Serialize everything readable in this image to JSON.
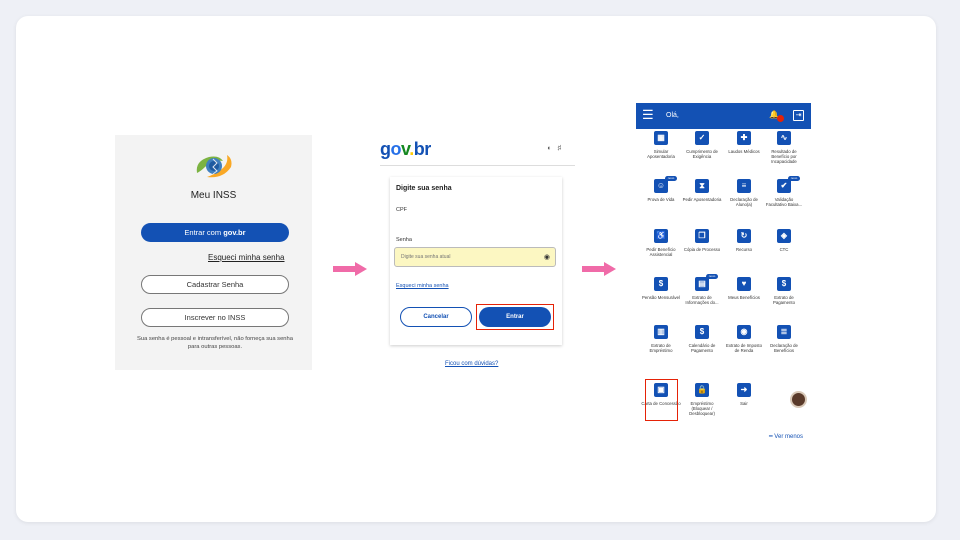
{
  "panel1": {
    "title": "Meu INSS",
    "login_prefix": "Entrar com ",
    "login_brand": "gov.br",
    "forgot": "Esqueci minha senha",
    "register": "Cadastrar Senha",
    "subscribe": "Inscrever no INSS",
    "note": "Sua senha é pessoal e intransferível, não forneça sua senha para outras pessoas."
  },
  "panel2": {
    "logo": [
      "g",
      "o",
      "v",
      ".",
      "br"
    ],
    "heading": "Digite sua senha",
    "cpf_label": "CPF",
    "password_label": "Senha",
    "password_placeholder": "Digite sua senha atual",
    "forgot": "Esqueci minha senha",
    "cancel": "Cancelar",
    "enter": "Entrar",
    "doubts": "Ficou com dúvidas?"
  },
  "panel3": {
    "greeting": "Olá,",
    "see_less": "━ Ver menos",
    "items": [
      {
        "label": "Simular Aposentadoria",
        "icon": "calculator-icon",
        "glyph": "▦"
      },
      {
        "label": "Cumprimento de Exigência",
        "icon": "check-icon",
        "glyph": "✓"
      },
      {
        "label": "Laudos Médicos",
        "icon": "medical-report-icon",
        "glyph": "✚"
      },
      {
        "label": "Resultado de Benefício por Incapacidade",
        "icon": "pulse-icon",
        "glyph": "∿"
      },
      {
        "label": "Prova de Vida",
        "icon": "face-scan-icon",
        "glyph": "☺",
        "badge": "novo"
      },
      {
        "label": "Pedir Aposentadoria",
        "icon": "hourglass-icon",
        "glyph": "⧗"
      },
      {
        "label": "Declaração de Aluno(a)",
        "icon": "document-icon",
        "glyph": "≡"
      },
      {
        "label": "Validação Facultativo Baixa...",
        "icon": "user-check-icon",
        "glyph": "✔",
        "badge": "novo"
      },
      {
        "label": "Pedir Benefício Assistencial",
        "icon": "wheelchair-icon",
        "glyph": "♿"
      },
      {
        "label": "Cópia de Processo",
        "icon": "copy-icon",
        "glyph": "❐"
      },
      {
        "label": "Recurso",
        "icon": "appeal-icon",
        "glyph": "↻"
      },
      {
        "label": "CTC",
        "icon": "certificate-icon",
        "glyph": "◈"
      },
      {
        "label": "Pensão Mensurável",
        "icon": "hand-coin-icon",
        "glyph": "$"
      },
      {
        "label": "Extrato de Informações do...",
        "icon": "statement-icon",
        "glyph": "▤",
        "badge": "novo"
      },
      {
        "label": "Meus Benefícios",
        "icon": "benefits-icon",
        "glyph": "♥"
      },
      {
        "label": "Extrato de Pagamento",
        "icon": "payment-statement-icon",
        "glyph": "$"
      },
      {
        "label": "Extrato de Empréstimo",
        "icon": "loan-statement-icon",
        "glyph": "▥"
      },
      {
        "label": "Calendário de Pagamento",
        "icon": "calendar-icon",
        "glyph": "$"
      },
      {
        "label": "Extrato de Imposto de Renda",
        "icon": "tax-icon",
        "glyph": "◉"
      },
      {
        "label": "Declaração de Benefícios",
        "icon": "declaration-icon",
        "glyph": "≣"
      },
      {
        "label": "Carta de Concessão",
        "icon": "award-letter-icon",
        "glyph": "▣"
      },
      {
        "label": "Empréstimo (Bloquear / Desbloquear)",
        "icon": "lock-hand-icon",
        "glyph": "🔒"
      },
      {
        "label": "Sair",
        "icon": "logout-icon",
        "glyph": "➜"
      }
    ]
  },
  "colors": {
    "primary": "#1351b4",
    "highlight": "#e52207",
    "arrow": "#f06ba8",
    "field": "#fcf7c2"
  }
}
